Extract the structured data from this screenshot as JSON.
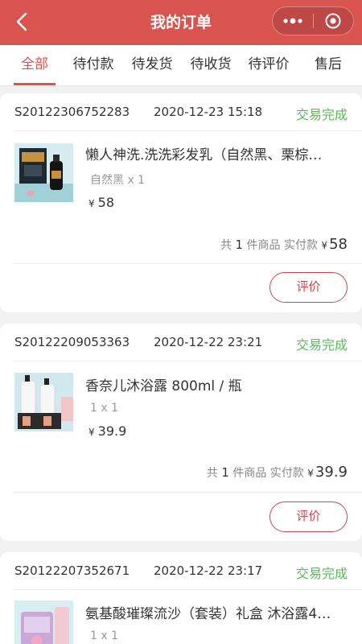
{
  "header": {
    "title": "我的订单"
  },
  "tabs": [
    {
      "label": "全部"
    },
    {
      "label": "待付款"
    },
    {
      "label": "待发货"
    },
    {
      "label": "待收货"
    },
    {
      "label": "待评价"
    },
    {
      "label": "售后"
    }
  ],
  "colors": {
    "brand": "#d9534f",
    "status_green": "#5cb85c",
    "button_red": "#c9474e"
  },
  "orders": [
    {
      "order_no": "S20122306752283",
      "time": "2020-12-23 15:18",
      "status": "交易完成",
      "product_name": "懒人神洗.洗洗彩发乳（自然黑、栗棕…",
      "spec": "自然黑 x 1",
      "price_symbol": "¥",
      "price": "58",
      "summary_prefix": "共",
      "summary_count": "1",
      "summary_mid": "件商品 实付款",
      "summary_symbol": "¥",
      "summary_total": "58",
      "button_label": "评价"
    },
    {
      "order_no": "S20122209053363",
      "time": "2020-12-22 23:21",
      "status": "交易完成",
      "product_name": "香奈儿沐浴露 800ml / 瓶",
      "spec": "1 x 1",
      "price_symbol": "¥",
      "price": "39.9",
      "summary_prefix": "共",
      "summary_count": "1",
      "summary_mid": "件商品 实付款",
      "summary_symbol": "¥",
      "summary_total": "39.9",
      "button_label": "评价"
    },
    {
      "order_no": "S20122207352671",
      "time": "2020-12-22 23:17",
      "status": "交易完成",
      "product_name": "氨基酸璀璨流沙（套装）礼盒 沐浴露4…",
      "spec": "1 x 1"
    }
  ]
}
